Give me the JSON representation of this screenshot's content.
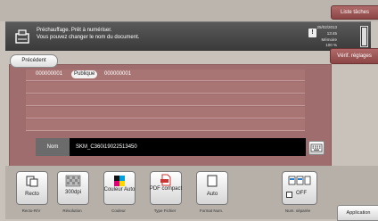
{
  "header": {
    "list_button": "Liste tâches",
    "message_line1": "Préchauffage. Prêt à numériser.",
    "message_line2": "Vous pouvez changer le nom du document.",
    "status": {
      "date": "25/02/2013",
      "time": "13:45",
      "memory_label": "Mémoire",
      "memory_value": "100 %"
    },
    "memory_level_percent": 100,
    "verif_button": "Vérif. réglages"
  },
  "nav": {
    "previous_button": "Précédent"
  },
  "filename": {
    "segment_1": "000000001",
    "segment_2": "Publique",
    "segment_3": "000000001"
  },
  "name_field": {
    "label": "Nom",
    "value": "SKM_C360i19022513450"
  },
  "toolbar": {
    "tiles": [
      {
        "label": "Recto",
        "caption": "Recto-R/V"
      },
      {
        "label": "300dpi",
        "caption": "Résolution"
      },
      {
        "label": "Couleur Auto",
        "caption": "Couleur"
      },
      {
        "label": "PDF compact",
        "caption": "Type Fichier"
      },
      {
        "label": "Auto",
        "caption": "Format Num."
      },
      {
        "label": "OFF",
        "caption": "Num. séparée"
      }
    ],
    "application_button": "Application"
  },
  "colors": {
    "accent": "#9f6d6d",
    "button_red": "#8c4545",
    "message_bar": "#3a3a3a"
  }
}
